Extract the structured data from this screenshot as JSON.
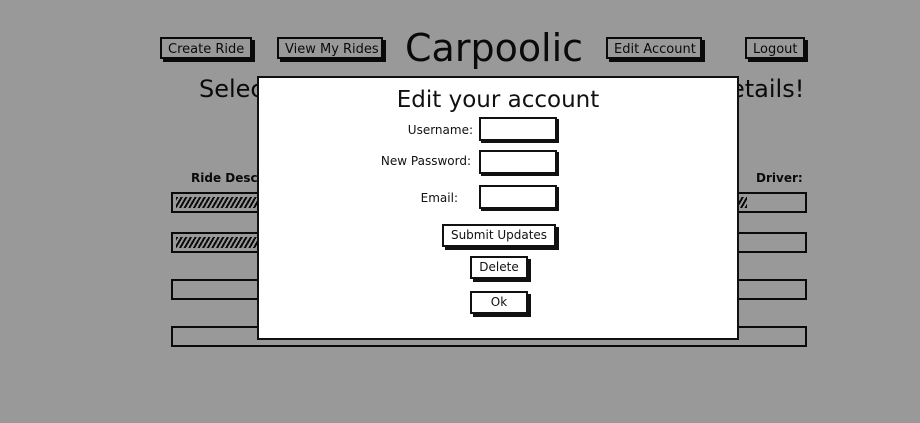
{
  "nav": {
    "create_ride": "Create Ride",
    "view_my_rides": "View My Rides",
    "logo": "Carpoolic",
    "edit_account": "Edit Account",
    "logout": "Logout"
  },
  "main": {
    "heading_left": "Selec",
    "heading_right": "etails!",
    "col_ride_desc": "Ride Descr",
    "col_driver": "Driver:"
  },
  "modal": {
    "title": "Edit your account",
    "username_label": "Username:",
    "username_value": "",
    "password_label": "New Password:",
    "password_value": "",
    "email_label": "Email:",
    "email_value": "",
    "submit_label": "Submit Updates",
    "delete_label": "Delete",
    "ok_label": "Ok"
  },
  "colors": {
    "overlay": "#999999",
    "ink": "#111111",
    "paper": "#ffffff"
  }
}
